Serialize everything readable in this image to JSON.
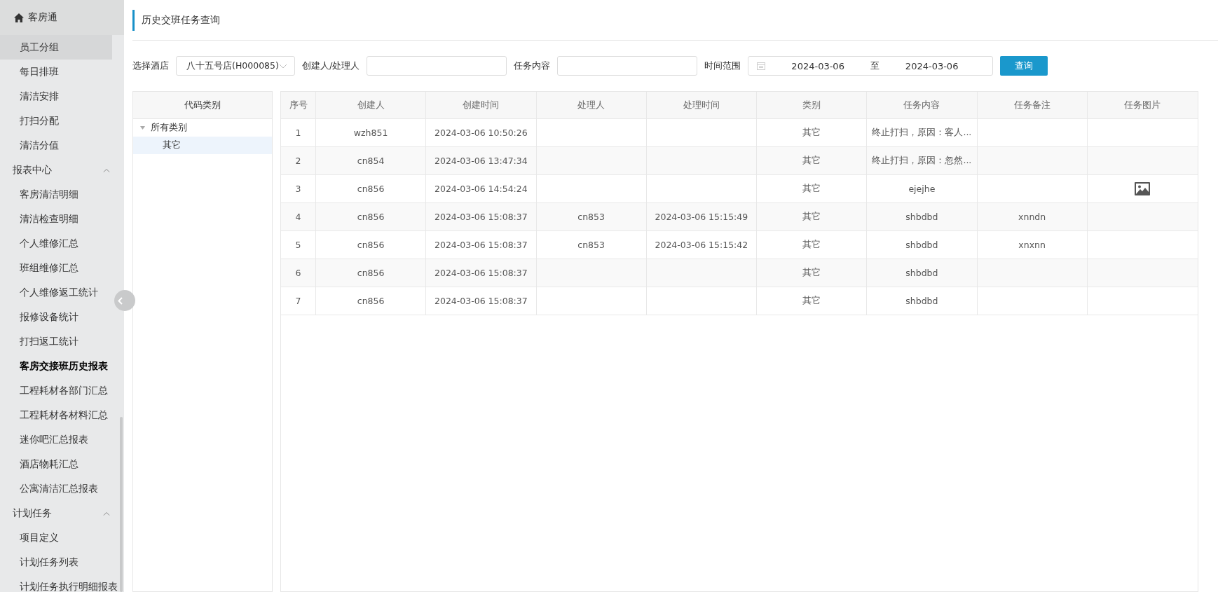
{
  "sidebar": {
    "app_title": "客房通",
    "groups": [
      {
        "items": [
          {
            "label": "员工分组",
            "selected": true
          },
          {
            "label": "每日排班",
            "selected": false
          },
          {
            "label": "清洁安排",
            "selected": false
          },
          {
            "label": "打扫分配",
            "selected": false
          },
          {
            "label": "清洁分值",
            "selected": false
          }
        ]
      },
      {
        "label": "报表中心",
        "expanded": true,
        "items": [
          {
            "label": "客房清洁明细",
            "selected": false
          },
          {
            "label": "清洁检查明细",
            "selected": false
          },
          {
            "label": "个人维修汇总",
            "selected": false
          },
          {
            "label": "班组维修汇总",
            "selected": false
          },
          {
            "label": "个人维修返工统计",
            "selected": false
          },
          {
            "label": "报修设备统计",
            "selected": false
          },
          {
            "label": "打扫返工统计",
            "selected": false
          },
          {
            "label": "客房交接班历史报表",
            "selected": false,
            "current": true
          },
          {
            "label": "工程耗材各部门汇总",
            "selected": false
          },
          {
            "label": "工程耗材各材料汇总",
            "selected": false
          },
          {
            "label": "迷你吧汇总报表",
            "selected": false
          },
          {
            "label": "酒店物耗汇总",
            "selected": false
          },
          {
            "label": "公寓清洁汇总报表",
            "selected": false
          }
        ]
      },
      {
        "label": "计划任务",
        "expanded": true,
        "items": [
          {
            "label": "项目定义",
            "selected": false
          },
          {
            "label": "计划任务列表",
            "selected": false
          },
          {
            "label": "计划任务执行明细报表",
            "selected": false
          }
        ]
      }
    ]
  },
  "page_title": "历史交班任务查询",
  "filters": {
    "hotel_label": "选择酒店",
    "hotel_value": "八十五号店(H000085)",
    "person_label": "创建人/处理人",
    "content_label": "任务内容",
    "range_label": "时间范围",
    "date_from": "2024-03-06",
    "range_sep": "至",
    "date_to": "2024-03-06",
    "search_button": "查询"
  },
  "tree": {
    "title": "代码类别",
    "nodes": [
      {
        "label": "所有类别",
        "expanded": true,
        "selected": false,
        "children": [
          {
            "label": "其它",
            "selected": true
          }
        ]
      }
    ]
  },
  "table": {
    "columns": [
      "序号",
      "创建人",
      "创建时间",
      "处理人",
      "处理时间",
      "类别",
      "任务内容",
      "任务备注",
      "任务图片"
    ],
    "rows": [
      {
        "cells": [
          "1",
          "wzh851",
          "2024-03-06 10:50:26",
          "",
          "",
          "其它",
          "终止打扫，原因：客人...",
          ""
        ],
        "has_image": false
      },
      {
        "cells": [
          "2",
          "cn854",
          "2024-03-06 13:47:34",
          "",
          "",
          "其它",
          "终止打扫，原因：忽然...",
          ""
        ],
        "has_image": false
      },
      {
        "cells": [
          "3",
          "cn856",
          "2024-03-06 14:54:24",
          "",
          "",
          "其它",
          "ejejhe",
          ""
        ],
        "has_image": true
      },
      {
        "cells": [
          "4",
          "cn856",
          "2024-03-06 15:08:37",
          "cn853",
          "2024-03-06 15:15:49",
          "其它",
          "shbdbd",
          "xnndn"
        ],
        "has_image": false
      },
      {
        "cells": [
          "5",
          "cn856",
          "2024-03-06 15:08:37",
          "cn853",
          "2024-03-06 15:15:42",
          "其它",
          "shbdbd",
          "xnxnn"
        ],
        "has_image": false
      },
      {
        "cells": [
          "6",
          "cn856",
          "2024-03-06 15:08:37",
          "",
          "",
          "其它",
          "shbdbd",
          ""
        ],
        "has_image": false
      },
      {
        "cells": [
          "7",
          "cn856",
          "2024-03-06 15:08:37",
          "",
          "",
          "其它",
          "shbdbd",
          ""
        ],
        "has_image": false
      }
    ]
  }
}
